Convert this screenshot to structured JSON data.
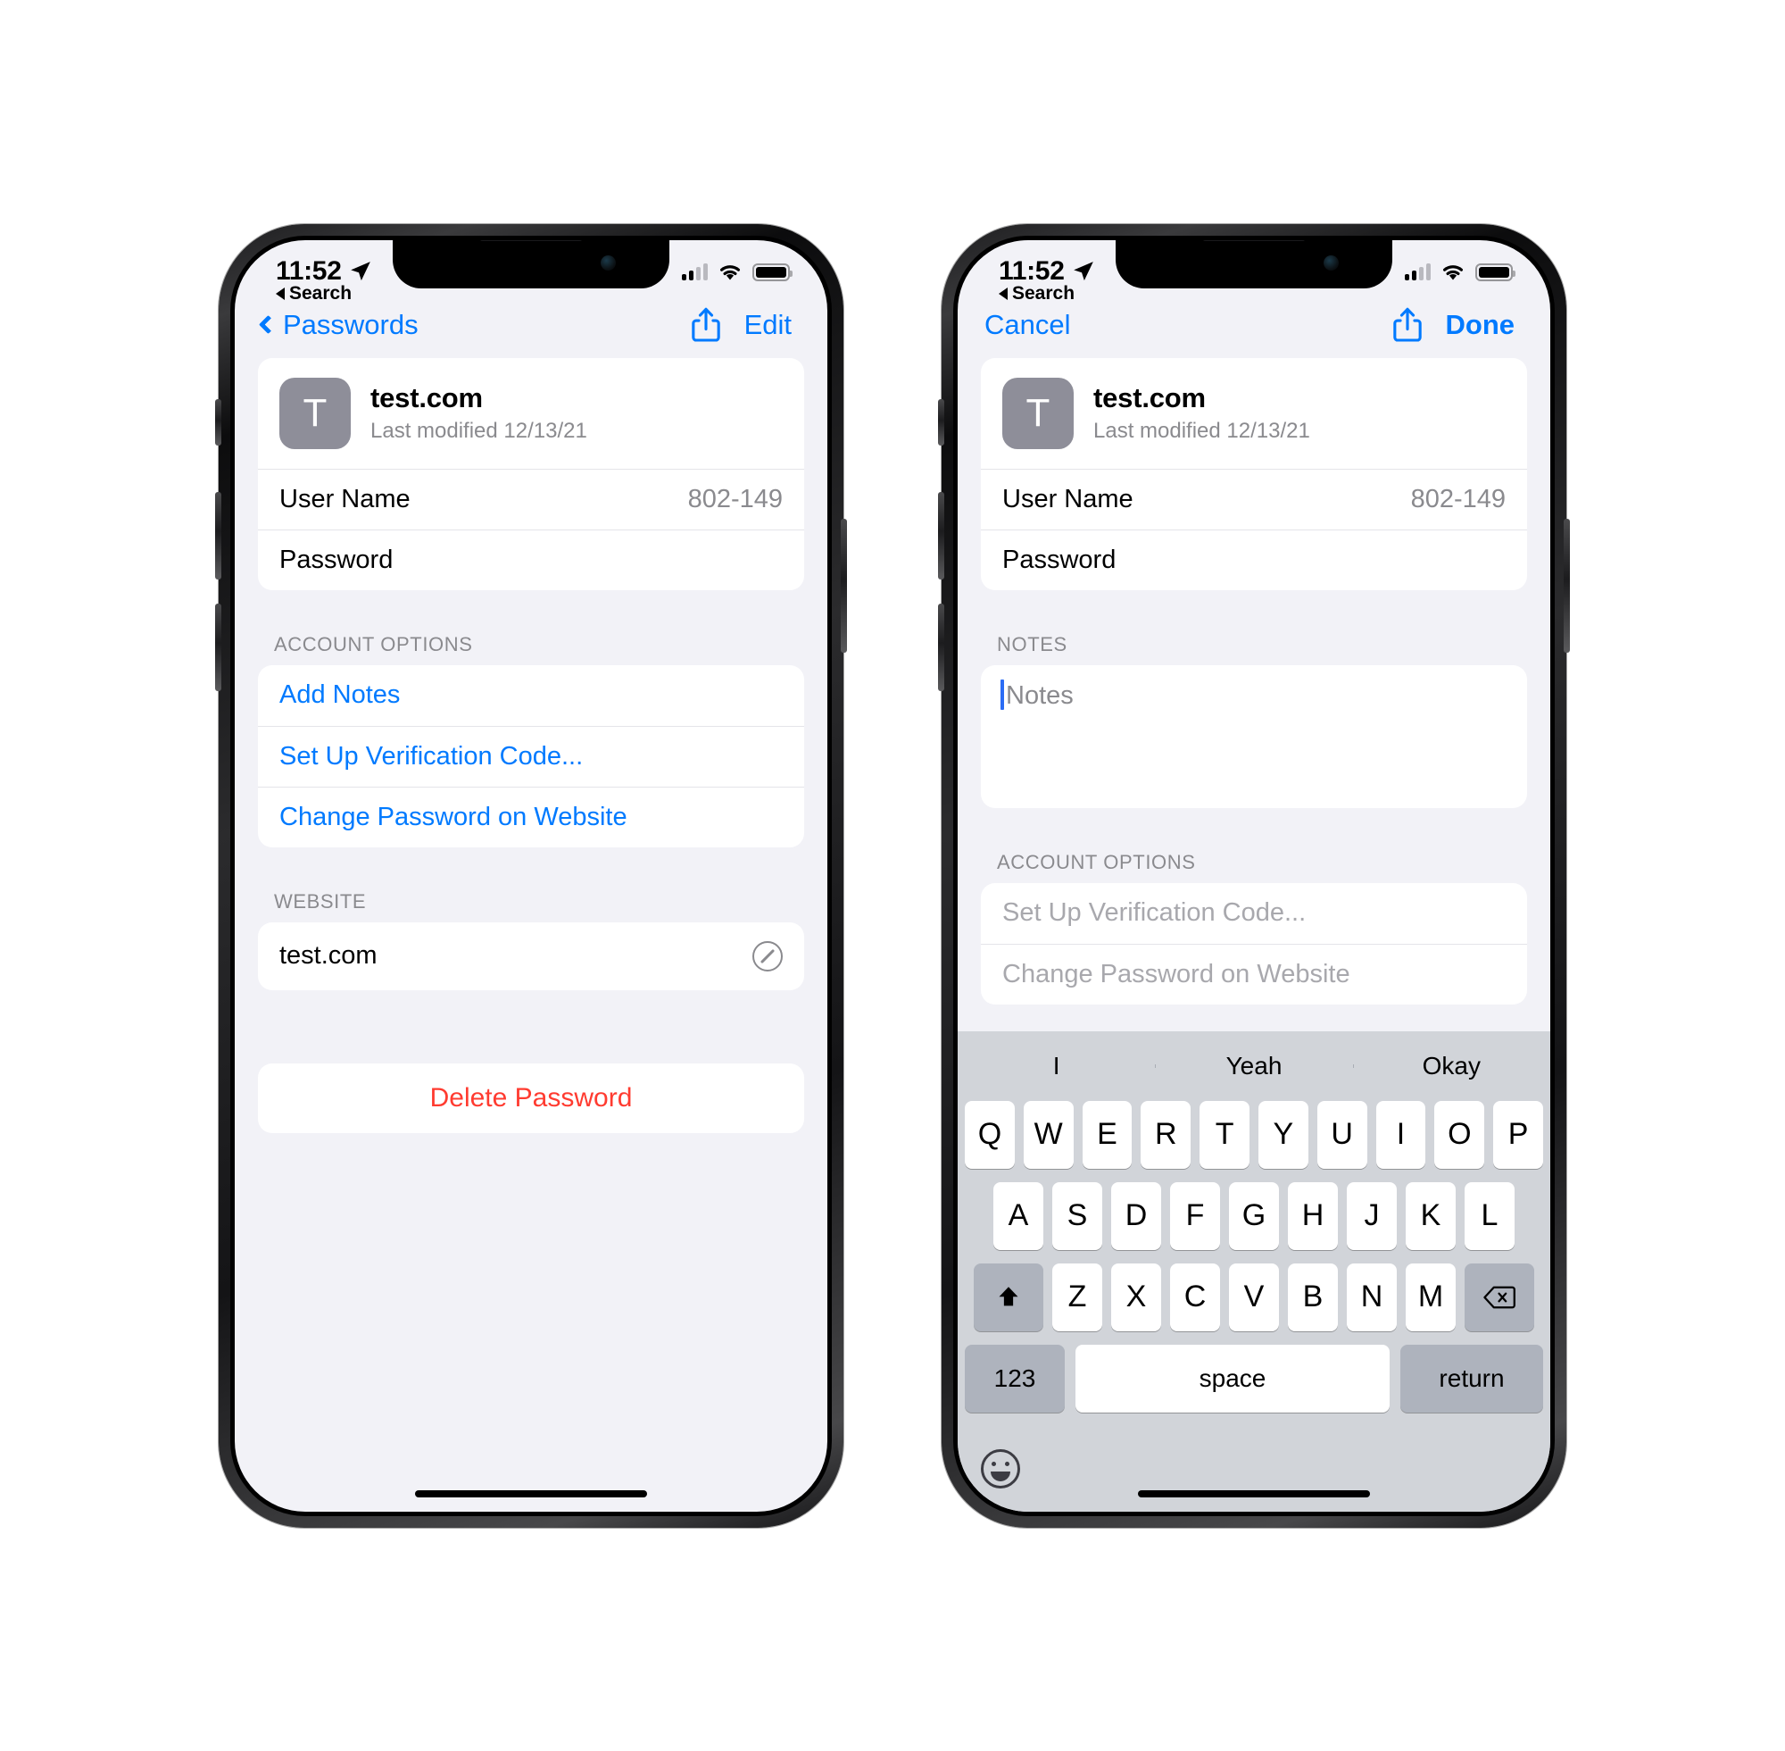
{
  "status_bar": {
    "time": "11:52",
    "location_icon": "location-arrow-icon",
    "signal_icon": "cellular-signal-icon",
    "wifi_icon": "wifi-icon",
    "battery_icon": "battery-full-icon",
    "back_to_app": "Search"
  },
  "phone_left": {
    "nav": {
      "back_label": "Passwords",
      "share_icon": "share-icon",
      "edit_label": "Edit"
    },
    "account": {
      "icon_letter": "T",
      "title": "test.com",
      "subtitle": "Last modified 12/13/21",
      "username_label": "User Name",
      "username_value": "802-149",
      "password_label": "Password"
    },
    "account_options": {
      "section_label": "ACCOUNT OPTIONS",
      "items": [
        {
          "label": "Add Notes"
        },
        {
          "label": "Set Up Verification Code..."
        },
        {
          "label": "Change Password on Website"
        }
      ]
    },
    "website": {
      "section_label": "WEBSITE",
      "value": "test.com",
      "open_icon": "safari-compass-icon"
    },
    "delete_label": "Delete Password"
  },
  "phone_right": {
    "nav": {
      "cancel_label": "Cancel",
      "share_icon": "share-icon",
      "done_label": "Done"
    },
    "account": {
      "icon_letter": "T",
      "title": "test.com",
      "subtitle": "Last modified 12/13/21",
      "username_label": "User Name",
      "username_value": "802-149",
      "password_label": "Password"
    },
    "notes": {
      "section_label": "NOTES",
      "placeholder": "Notes",
      "value": ""
    },
    "account_options": {
      "section_label": "ACCOUNT OPTIONS",
      "items": [
        {
          "label": "Set Up Verification Code..."
        },
        {
          "label": "Change Password on Website"
        }
      ]
    },
    "keyboard": {
      "predictions": [
        "I",
        "Yeah",
        "Okay"
      ],
      "row1": [
        "Q",
        "W",
        "E",
        "R",
        "T",
        "Y",
        "U",
        "I",
        "O",
        "P"
      ],
      "row2": [
        "A",
        "S",
        "D",
        "F",
        "G",
        "H",
        "J",
        "K",
        "L"
      ],
      "row3": [
        "Z",
        "X",
        "C",
        "V",
        "B",
        "N",
        "M"
      ],
      "shift_icon": "shift-arrow-icon",
      "backspace_icon": "backspace-icon",
      "numbers_label": "123",
      "space_label": "space",
      "return_label": "return",
      "emoji_icon": "emoji-smiley-icon"
    }
  },
  "colors": {
    "accent_blue": "#007aff",
    "destructive_red": "#ff3b30",
    "page_bg": "#f2f2f7",
    "card_bg": "#ffffff",
    "secondary_text": "#8a8a8e",
    "disabled_text": "#a8a8ad",
    "keyboard_bg": "#d1d4d9"
  }
}
